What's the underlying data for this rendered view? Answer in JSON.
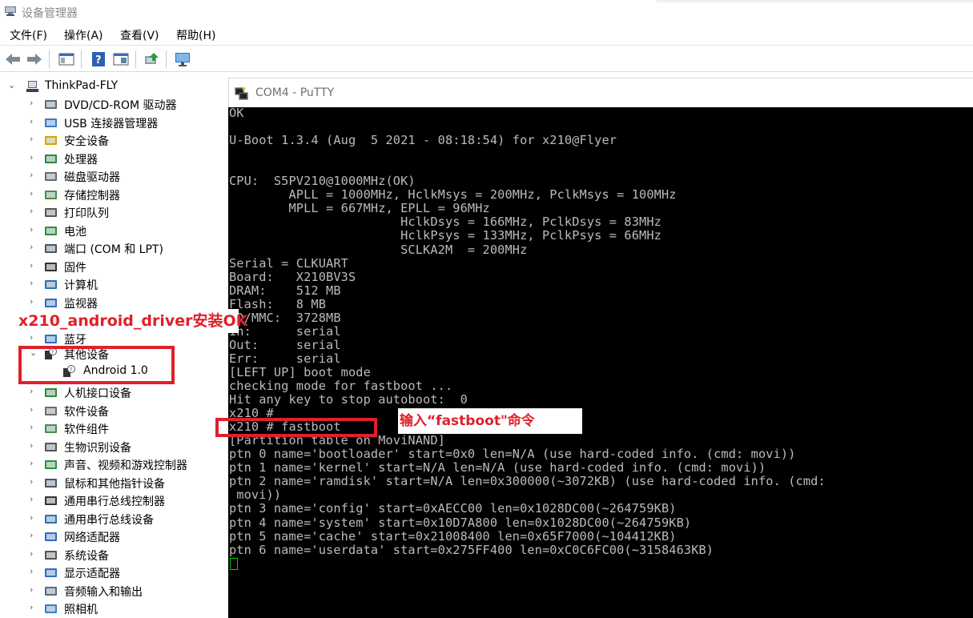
{
  "device_manager": {
    "title": "设备管理器",
    "menu": [
      "文件(F)",
      "操作(A)",
      "查看(V)",
      "帮助(H)"
    ],
    "computer_name": "ThinkPad-FLY",
    "tree": [
      {
        "label": "DVD/CD-ROM 驱动器",
        "icon": "dvd-drive-icon"
      },
      {
        "label": "USB 连接器管理器",
        "icon": "usb-connector-icon"
      },
      {
        "label": "安全设备",
        "icon": "security-device-icon"
      },
      {
        "label": "处理器",
        "icon": "processor-icon"
      },
      {
        "label": "磁盘驱动器",
        "icon": "disk-drive-icon"
      },
      {
        "label": "存储控制器",
        "icon": "storage-controller-icon"
      },
      {
        "label": "打印队列",
        "icon": "printer-icon"
      },
      {
        "label": "电池",
        "icon": "battery-icon"
      },
      {
        "label": "端口 (COM 和 LPT)",
        "icon": "port-icon"
      },
      {
        "label": "固件",
        "icon": "firmware-icon"
      },
      {
        "label": "计算机",
        "icon": "computer-icon"
      },
      {
        "label": "监视器",
        "icon": "monitor-icon"
      },
      {
        "label": "",
        "icon": "keyboard-icon"
      },
      {
        "label": "蓝牙",
        "icon": "bluetooth-icon"
      }
    ],
    "other_devices": {
      "label": "其他设备",
      "child": "Android 1.0"
    },
    "tree_after": [
      {
        "label": "人机接口设备",
        "icon": "hid-icon"
      },
      {
        "label": "软件设备",
        "icon": "software-device-icon"
      },
      {
        "label": "软件组件",
        "icon": "software-component-icon"
      },
      {
        "label": "生物识别设备",
        "icon": "biometric-icon"
      },
      {
        "label": "声音、视频和游戏控制器",
        "icon": "sound-icon"
      },
      {
        "label": "鼠标和其他指针设备",
        "icon": "mouse-icon"
      },
      {
        "label": "通用串行总线控制器",
        "icon": "usb-controller-icon"
      },
      {
        "label": "通用串行总线设备",
        "icon": "usb-device-icon"
      },
      {
        "label": "网络适配器",
        "icon": "network-adapter-icon"
      },
      {
        "label": "系统设备",
        "icon": "system-device-icon"
      },
      {
        "label": "显示适配器",
        "icon": "display-adapter-icon"
      },
      {
        "label": "音频输入和输出",
        "icon": "audio-io-icon"
      },
      {
        "label": "照相机",
        "icon": "camera-icon"
      }
    ]
  },
  "putty": {
    "title": "COM4 - PuTTY",
    "lines": [
      "OK",
      "",
      "U-Boot 1.3.4 (Aug  5 2021 - 08:18:54) for x210@Flyer",
      "",
      "",
      "CPU:  S5PV210@1000MHz(OK)",
      "        APLL = 1000MHz, HclkMsys = 200MHz, PclkMsys = 100MHz",
      "        MPLL = 667MHz, EPLL = 96MHz",
      "                       HclkDsys = 166MHz, PclkDsys = 83MHz",
      "                       HclkPsys = 133MHz, PclkPsys = 66MHz",
      "                       SCLKA2M  = 200MHz",
      "Serial = CLKUART",
      "Board:   X210BV3S",
      "DRAM:    512 MB",
      "Flash:   8 MB",
      "SD/MMC:  3728MB",
      "In:      serial",
      "Out:     serial",
      "Err:     serial",
      "[LEFT UP] boot mode",
      "checking mode for fastboot ...",
      "Hit any key to stop autoboot:  0",
      "x210 #",
      "x210 # fastboot",
      "[Partition table on MoviNAND]",
      "ptn 0 name='bootloader' start=0x0 len=N/A (use hard-coded info. (cmd: movi))",
      "ptn 1 name='kernel' start=N/A len=N/A (use hard-coded info. (cmd: movi))",
      "ptn 2 name='ramdisk' start=N/A len=0x300000(~3072KB) (use hard-coded info. (cmd:",
      " movi))",
      "ptn 3 name='config' start=0xAECC00 len=0x1028DC00(~264759KB)",
      "ptn 4 name='system' start=0x10D7A800 len=0x1028DC00(~264759KB)",
      "ptn 5 name='cache' start=0x21008400 len=0x65F7000(~104412KB)",
      "ptn 6 name='userdata' start=0x275FF400 len=0xC0C6FC00(~3158463KB)"
    ]
  },
  "annotations": {
    "driver_ok": "x210_android_driver安装OK",
    "fastboot_cmd": "输入“fastboot\"命令"
  },
  "colors": {
    "annotation": "#e0202a",
    "terminal_text": "#bbbbbb",
    "cursor": "#00d000"
  }
}
